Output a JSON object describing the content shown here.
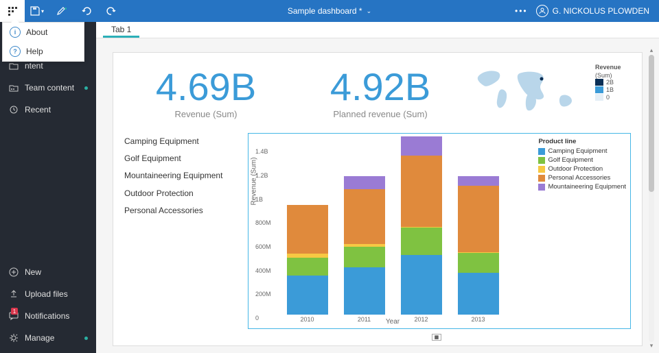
{
  "topbar": {
    "title": "Sample dashboard *",
    "user": "G. NICKOLUS PLOWDEN"
  },
  "menu": {
    "about": "About",
    "help": "Help"
  },
  "sidebar": {
    "content": "ntent",
    "team_content": "Team content",
    "recent": "Recent",
    "new": "New",
    "upload": "Upload files",
    "notifications": "Notifications",
    "notifications_badge": "1",
    "manage": "Manage"
  },
  "tabs": {
    "tab1": "Tab 1"
  },
  "kpi1": {
    "value": "4.69B",
    "label": "Revenue (Sum)"
  },
  "kpi2": {
    "value": "4.92B",
    "label": "Planned revenue (Sum)"
  },
  "map_legend": {
    "title": "Revenue",
    "subtitle": "(Sum)",
    "b2": "2B",
    "b1": "1B",
    "b0": "0"
  },
  "product_lines": {
    "p0": "Camping Equipment",
    "p1": "Golf Equipment",
    "p2": "Mountaineering Equipment",
    "p3": "Outdoor Protection",
    "p4": "Personal Accessories"
  },
  "chart_meta": {
    "legend_title": "Product line",
    "y_label": "Revenue (Sum)",
    "x_label": "Year",
    "y0": "0",
    "y1": "200M",
    "y2": "400M",
    "y3": "600M",
    "y4": "800M",
    "y5": "1B",
    "y6": "1.2B",
    "y7": "1.4B",
    "x2010": "2010",
    "x2011": "2011",
    "x2012": "2012",
    "x2013": "2013"
  },
  "chart_data": {
    "type": "bar",
    "stacked": true,
    "xlabel": "Year",
    "ylabel": "Revenue (Sum)",
    "ylim": [
      0,
      1500000000
    ],
    "categories": [
      "2010",
      "2011",
      "2012",
      "2013"
    ],
    "series": [
      {
        "name": "Camping Equipment",
        "color": "#3b9bd8",
        "values": [
          330000000,
          400000000,
          500000000,
          350000000
        ]
      },
      {
        "name": "Golf Equipment",
        "color": "#7fc241",
        "values": [
          150000000,
          170000000,
          230000000,
          170000000
        ]
      },
      {
        "name": "Outdoor Protection",
        "color": "#f7c843",
        "values": [
          36000000,
          25000000,
          10000000,
          5000000
        ]
      },
      {
        "name": "Personal Accessories",
        "color": "#e08a3c",
        "values": [
          410000000,
          460000000,
          600000000,
          560000000
        ]
      },
      {
        "name": "Mountaineering Equipment",
        "color": "#9a7bd4",
        "values": [
          0,
          110000000,
          160000000,
          80000000
        ]
      }
    ],
    "legend_title": "Product line"
  },
  "colors": {
    "camping": "#3b9bd8",
    "golf": "#7fc241",
    "outdoor": "#f7c843",
    "personal": "#e08a3c",
    "mountain": "#9a7bd4"
  }
}
